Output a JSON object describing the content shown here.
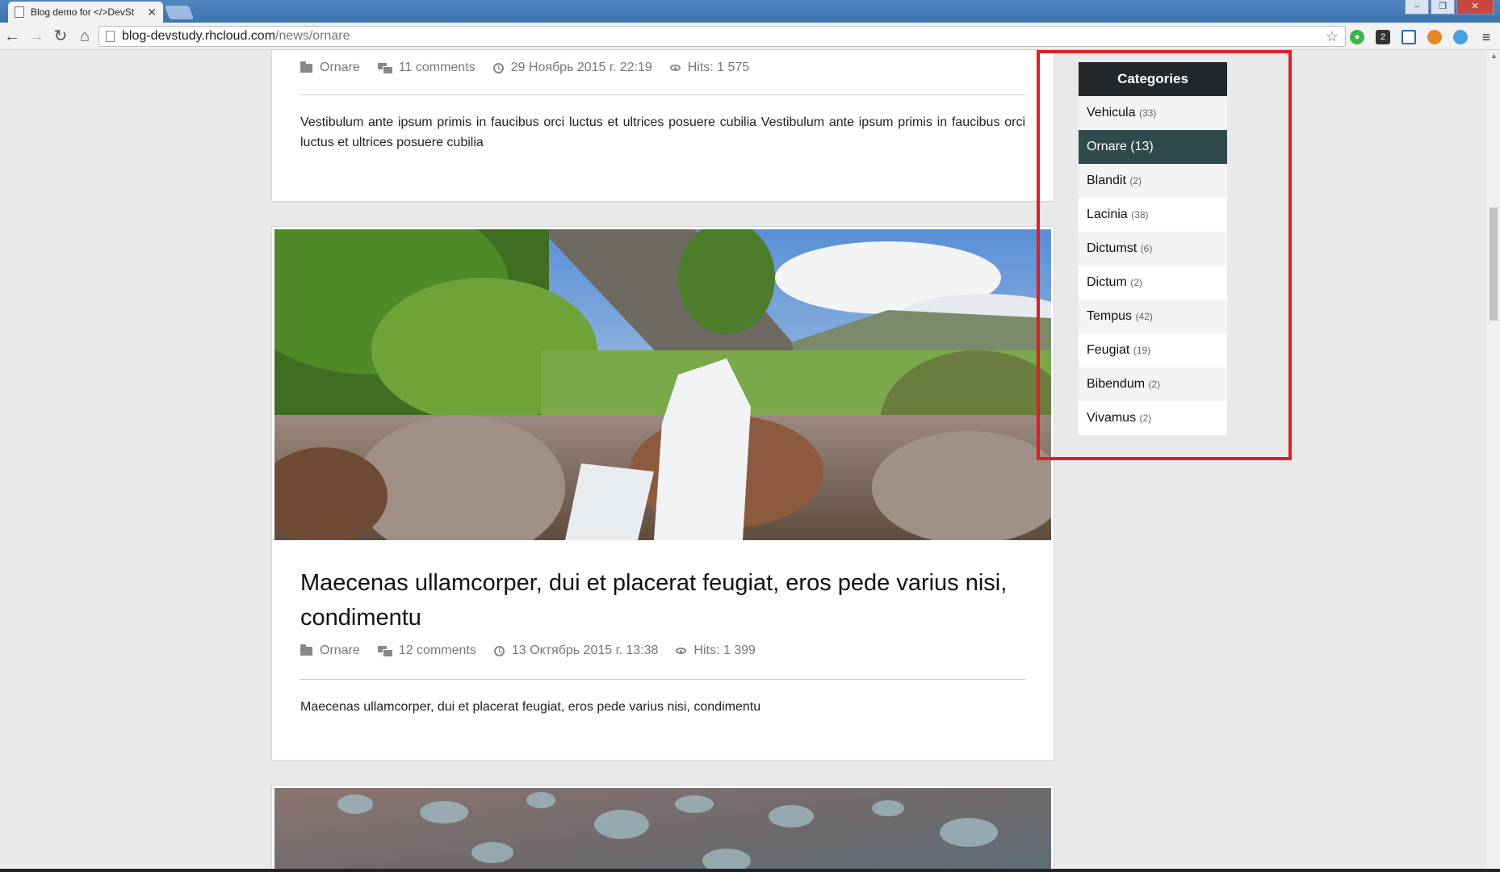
{
  "browser": {
    "tab_title": "Blog demo for </>DevSt",
    "tab_close": "✕",
    "url_host": "blog-devstudy.rhcloud.com",
    "url_path": "/news/ornare",
    "back_icon": "arrow-left-icon",
    "forward_icon": "arrow-right-icon",
    "reload_icon": "reload-icon",
    "home_icon": "home-icon",
    "star_icon": "star-icon",
    "menu_icon": "hamburger-menu-icon",
    "ext_badge": "2"
  },
  "posts": [
    {
      "category": "Ornare",
      "comments": "11 comments",
      "date": "29 Ноябрь 2015 г. 22:19",
      "hits": "Hits: 1 575",
      "excerpt": "Vestibulum ante ipsum primis in faucibus orci luctus et ultrices posuere cubilia Vestibulum ante ipsum primis in faucibus orci luctus et ultrices posuere cubilia"
    },
    {
      "title": "Maecenas ullamcorper, dui et placerat feugiat, eros pede varius nisi, condimentu",
      "category": "Ornare",
      "comments": "12 comments",
      "date": "13 Октябрь 2015 г. 13:38",
      "hits": "Hits: 1 399",
      "excerpt": "Maecenas ullamcorper, dui et placerat feugiat, eros pede varius nisi, condimentu"
    }
  ],
  "sidebar": {
    "title": "Categories",
    "items": [
      {
        "name": "Vehicula",
        "count": "(33)"
      },
      {
        "name": "Ornare",
        "count": "(13)"
      },
      {
        "name": "Blandit",
        "count": "(2)"
      },
      {
        "name": "Lacinia",
        "count": "(38)"
      },
      {
        "name": "Dictumst",
        "count": "(6)"
      },
      {
        "name": "Dictum",
        "count": "(2)"
      },
      {
        "name": "Tempus",
        "count": "(42)"
      },
      {
        "name": "Feugiat",
        "count": "(19)"
      },
      {
        "name": "Bibendum",
        "count": "(2)"
      },
      {
        "name": "Vivamus",
        "count": "(2)"
      }
    ],
    "active": "Ornare"
  },
  "colors": {
    "highlight_box": "#e11d26",
    "sidebar_header": "#22282b",
    "active_item": "#2f4a4a"
  }
}
